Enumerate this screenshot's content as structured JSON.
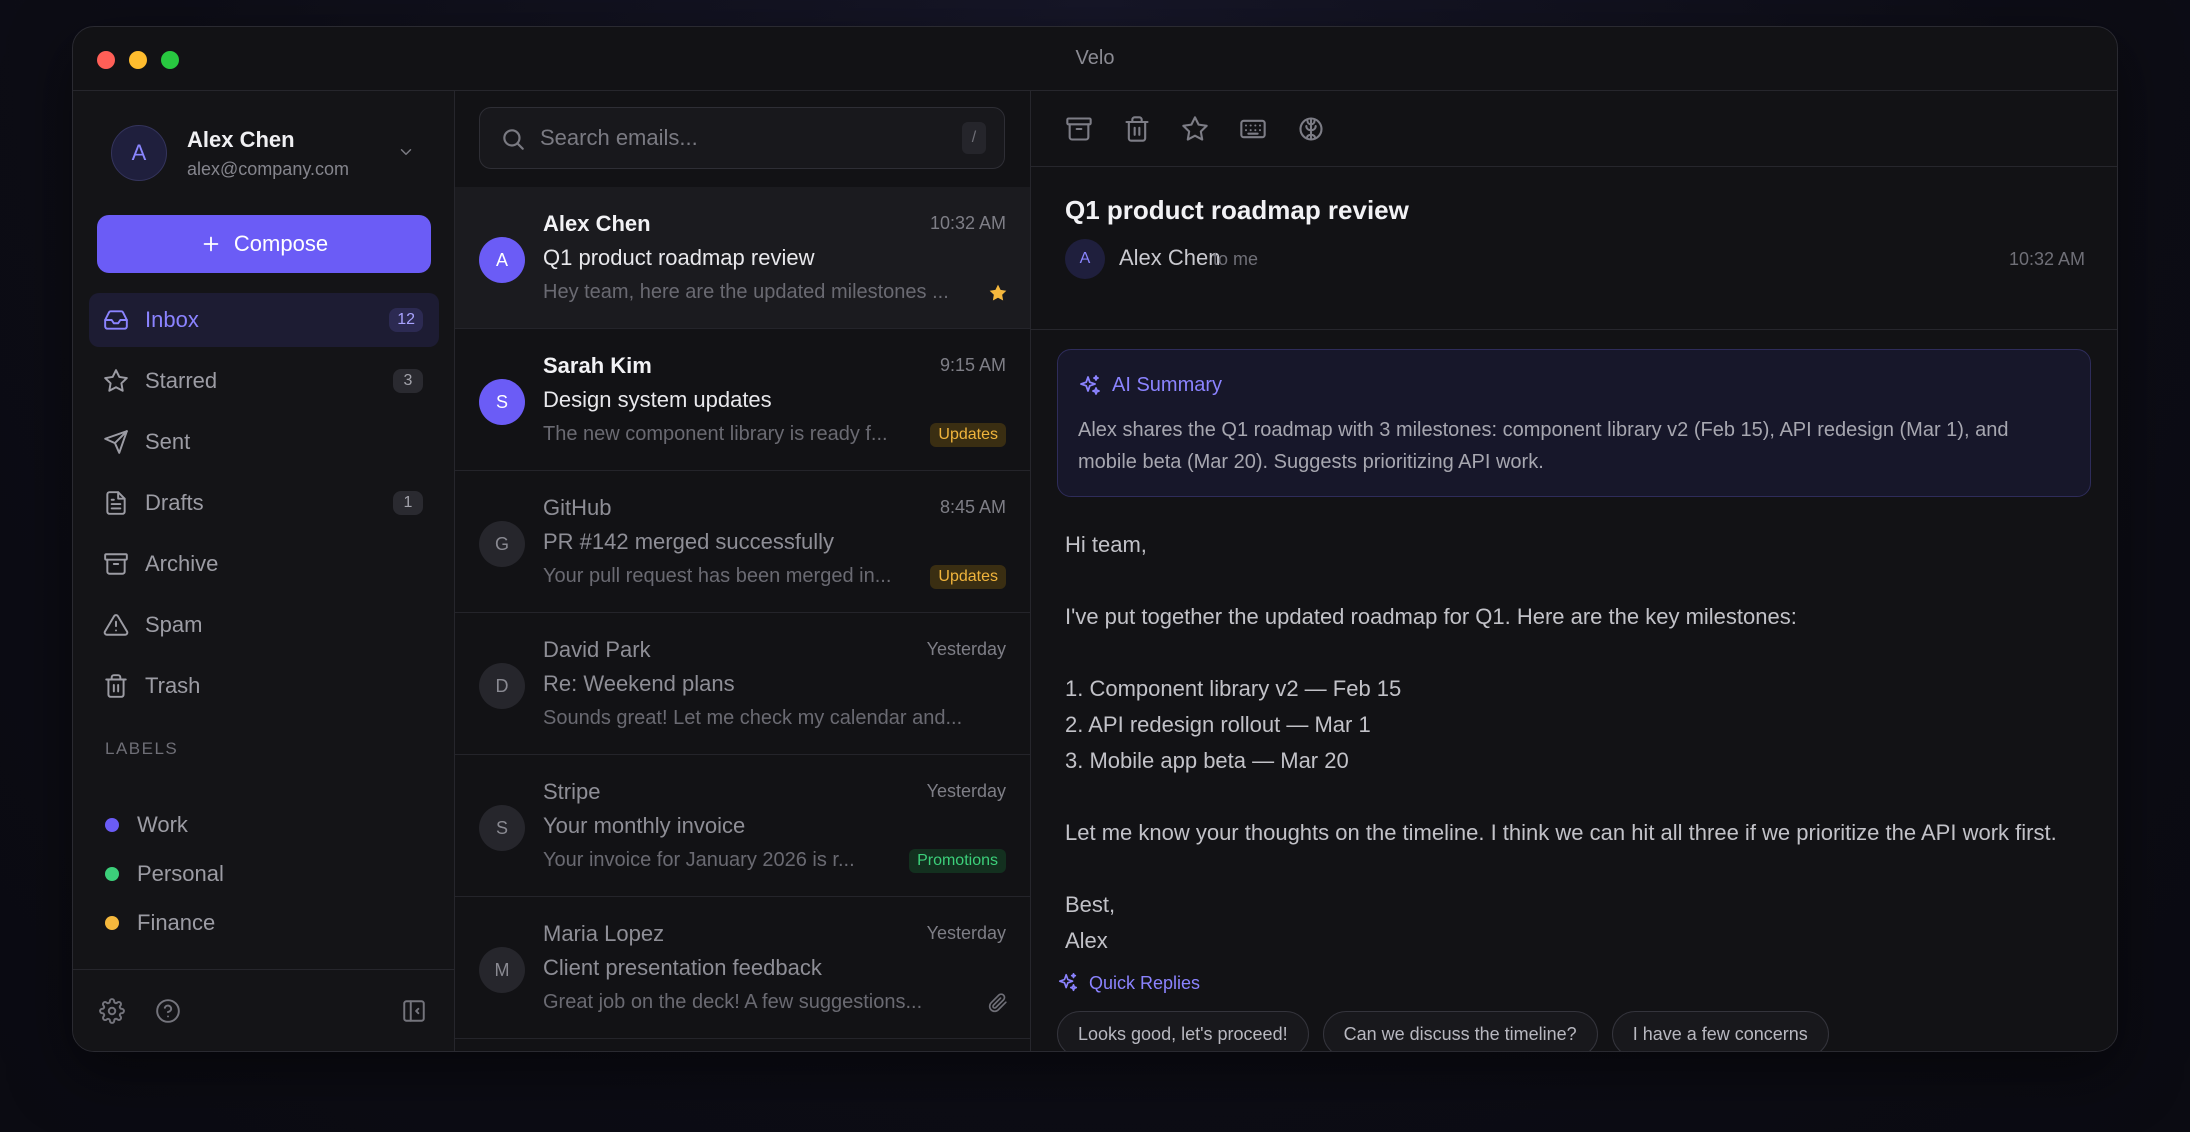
{
  "window": {
    "title": "Velo"
  },
  "account": {
    "initial": "A",
    "name": "Alex Chen",
    "email": "alex@company.com"
  },
  "compose": {
    "label": "Compose"
  },
  "nav": [
    {
      "label": "Inbox",
      "count": "12",
      "icon": "inbox-icon"
    },
    {
      "label": "Starred",
      "count": "3",
      "icon": "star-icon"
    },
    {
      "label": "Sent",
      "count": "",
      "icon": "send-icon"
    },
    {
      "label": "Drafts",
      "count": "1",
      "icon": "file-icon"
    },
    {
      "label": "Archive",
      "count": "",
      "icon": "archive-icon"
    },
    {
      "label": "Spam",
      "count": "",
      "icon": "warning-icon"
    },
    {
      "label": "Trash",
      "count": "",
      "icon": "trash-icon"
    }
  ],
  "labels": {
    "heading": "LABELS",
    "items": [
      {
        "name": "Work",
        "color": "#6b5cf6"
      },
      {
        "name": "Personal",
        "color": "#3ccf7a"
      },
      {
        "name": "Finance",
        "color": "#f5b83d"
      }
    ]
  },
  "search": {
    "placeholder": "Search emails...",
    "shortcut": "/"
  },
  "emails": [
    {
      "initial": "A",
      "from": "Alex Chen",
      "time": "10:32 AM",
      "subject": "Q1 product roadmap review",
      "preview": "Hey team, here are the updated milestones ...",
      "tag": "",
      "flag": "star"
    },
    {
      "initial": "S",
      "from": "Sarah Kim",
      "time": "9:15 AM",
      "subject": "Design system updates",
      "preview": "The new component library is ready f...",
      "tag": "Updates",
      "flag": ""
    },
    {
      "initial": "G",
      "from": "GitHub",
      "time": "8:45 AM",
      "subject": "PR #142 merged successfully",
      "preview": "Your pull request has been merged in...",
      "tag": "Updates",
      "flag": ""
    },
    {
      "initial": "D",
      "from": "David Park",
      "time": "Yesterday",
      "subject": "Re: Weekend plans",
      "preview": "Sounds great! Let me check my calendar and...",
      "tag": "",
      "flag": ""
    },
    {
      "initial": "S",
      "from": "Stripe",
      "time": "Yesterday",
      "subject": "Your monthly invoice",
      "preview": "Your invoice for January 2026 is r...",
      "tag": "Promotions",
      "flag": ""
    },
    {
      "initial": "M",
      "from": "Maria Lopez",
      "time": "Yesterday",
      "subject": "Client presentation feedback",
      "preview": "Great job on the deck! A few suggestions...",
      "tag": "",
      "flag": "attachment"
    }
  ],
  "message": {
    "subject": "Q1 product roadmap review",
    "sender_initial": "A",
    "sender": "Alex Chen",
    "to": "to me",
    "time": "10:32 AM",
    "summary_title": "AI Summary",
    "summary": "Alex shares the Q1 roadmap with 3 milestones: component library v2 (Feb 15), API redesign (Mar 1), and mobile beta (Mar 20). Suggests prioritizing API work.",
    "body": {
      "greeting": "Hi team,",
      "intro": "I've put together the updated roadmap for Q1. Here are the key milestones:",
      "item1": "1. Component library v2 — Feb 15",
      "item2": "2. API redesign rollout — Mar 1",
      "item3": "3. Mobile app beta — Mar 20",
      "closing": "Let me know your thoughts on the timeline. I think we can hit all three if we prioritize the API work first.",
      "signoff": "Best,",
      "signature": "Alex"
    }
  },
  "quick_replies": {
    "title": "Quick Replies",
    "options": [
      "Looks good, let's proceed!",
      "Can we discuss the timeline?",
      "I have a few concerns"
    ]
  }
}
